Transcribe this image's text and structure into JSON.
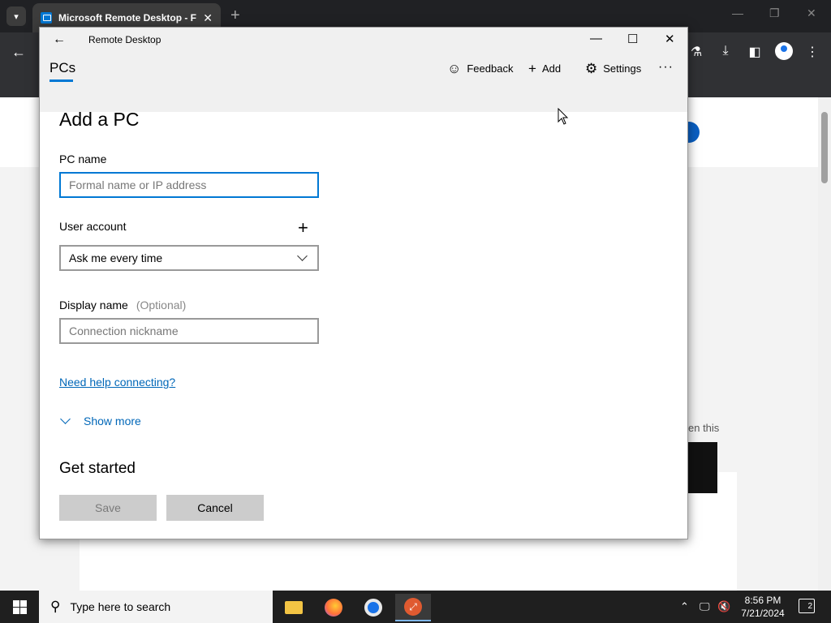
{
  "browser": {
    "tab_title": "Microsoft Remote Desktop - F",
    "new_tab": "+",
    "page_partial_text": "en this"
  },
  "window": {
    "title": "Remote Desktop",
    "minimize": "—",
    "maximize": "☐",
    "close": "✕"
  },
  "nav": {
    "pcs_tab": "PCs",
    "feedback_label": "Feedback",
    "add_label": "Add",
    "settings_label": "Settings",
    "more": "···"
  },
  "form": {
    "title": "Add a PC",
    "pc_name_label": "PC name",
    "pc_name_placeholder": "Formal name or IP address",
    "user_account_label": "User account",
    "user_account_value": "Ask me every time",
    "add_user": "+",
    "display_name_label": "Display name",
    "display_name_optional": "(Optional)",
    "display_name_placeholder": "Connection nickname",
    "help_link": "Need help connecting?",
    "show_more": "Show more",
    "get_started": "Get started",
    "save_label": "Save",
    "cancel_label": "Cancel"
  },
  "taskbar": {
    "search_placeholder": "Type here to search",
    "time": "8:56 PM",
    "date": "7/21/2024",
    "notification_count": "2"
  },
  "colors": {
    "accent": "#0078d4",
    "link": "#0067b8",
    "taskbar": "#1f1f1f"
  }
}
